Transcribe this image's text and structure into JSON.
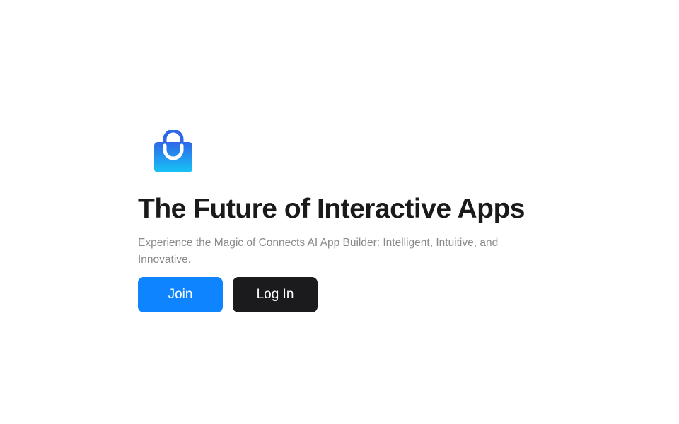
{
  "logo": {
    "icon": "shopping-bag-icon",
    "color_top": "#2f67e8",
    "color_bottom": "#17c4f5"
  },
  "hero": {
    "title": "The Future of Interactive Apps",
    "subtitle": "Experience the Magic of Connects AI App Builder: Intelligent, Intuitive, and Innovative."
  },
  "actions": {
    "join_label": "Join",
    "login_label": "Log In"
  },
  "colors": {
    "primary": "#0f84ff",
    "dark": "#1b1b1d",
    "heading": "#1a1a1a",
    "muted": "#8a8a8a"
  }
}
